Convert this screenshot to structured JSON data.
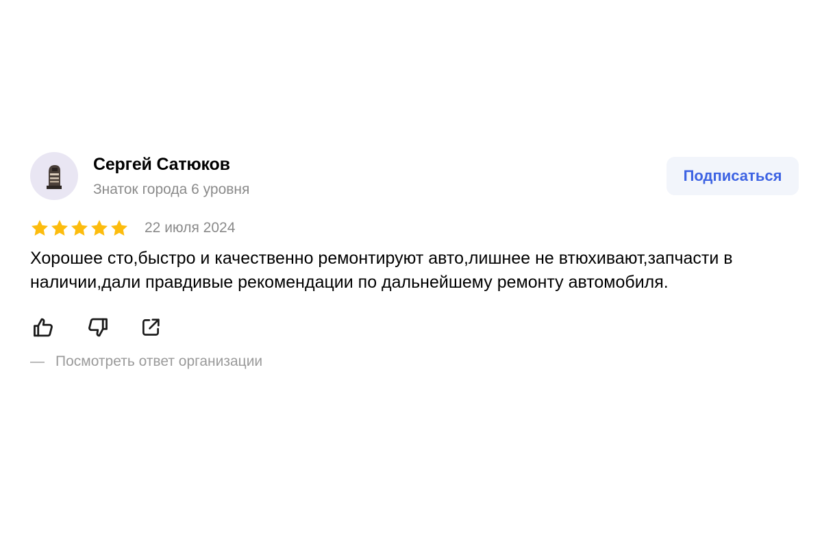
{
  "review": {
    "author": {
      "name": "Сергей Сатюков",
      "level": "Знаток города 6 уровня",
      "avatar_icon": "moai-statue-icon"
    },
    "subscribe_label": "Подписаться",
    "rating": {
      "value": 5,
      "max": 5,
      "star_color": "#fcbc0e"
    },
    "date": "22 июля 2024",
    "text": "Хорошее сто,быстро и качественно ремонтируют авто,лишнее не втюхивают,запчасти в наличии,дали правдивые рекомендации по дальнейшему ремонту автомобиля.",
    "actions": {
      "like_icon": "thumbs-up-icon",
      "dislike_icon": "thumbs-down-icon",
      "share_icon": "share-icon"
    },
    "org_reply": {
      "dash": "—",
      "label": "Посмотреть ответ организации"
    }
  },
  "colors": {
    "accent": "#3d63e3",
    "muted_text": "#8a8a8a",
    "button_bg": "#f2f5fb",
    "avatar_bg": "#e9e6f3"
  }
}
